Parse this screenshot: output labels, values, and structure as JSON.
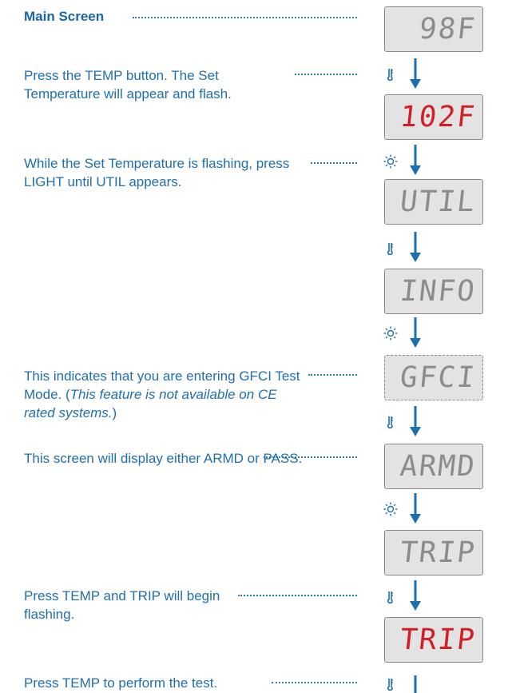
{
  "steps": [
    {
      "id": "main",
      "title": "Main Screen"
    },
    {
      "id": "s1",
      "text": "Press the TEMP button. The Set Temperature will appear and flash."
    },
    {
      "id": "s2",
      "text": "While the Set Temperature is flashing, press LIGHT until UTIL appears."
    },
    {
      "id": "s3",
      "text_main": "This indicates that you are entering GFCI Test Mode. (",
      "text_italic": "This feature is not available on CE rated systems.",
      "text_end": ")"
    },
    {
      "id": "s4",
      "text": "This screen will display either ARMD or PASS."
    },
    {
      "id": "s5",
      "text": "Press TEMP and TRIP will begin flashing."
    },
    {
      "id": "s6",
      "text": "Press TEMP to perform the test."
    }
  ],
  "displays": [
    {
      "label": "98F",
      "color": "#8c8c8c"
    },
    {
      "label": "102F",
      "color": "#d21f26"
    },
    {
      "label": "UTIL",
      "color": "#8c8c8c"
    },
    {
      "label": "INFO",
      "color": "#8c8c8c"
    },
    {
      "label": "GFCI",
      "color": "#8c8c8c"
    },
    {
      "label": "ARMD",
      "color": "#8c8c8c"
    },
    {
      "label": "TRIP",
      "color": "#8c8c8c"
    },
    {
      "label": "TRIP",
      "color": "#d21f26"
    }
  ],
  "icons": {
    "temp": "thermometer-icon",
    "light": "light-icon",
    "arrow": "down-arrow-icon"
  },
  "colors": {
    "text": "#1f6faf",
    "arrow": "#1d6fae",
    "lcd_bg": "#e3e3e3",
    "lcd_digit": "#8c8c8c",
    "lcd_red": "#d21f26"
  }
}
